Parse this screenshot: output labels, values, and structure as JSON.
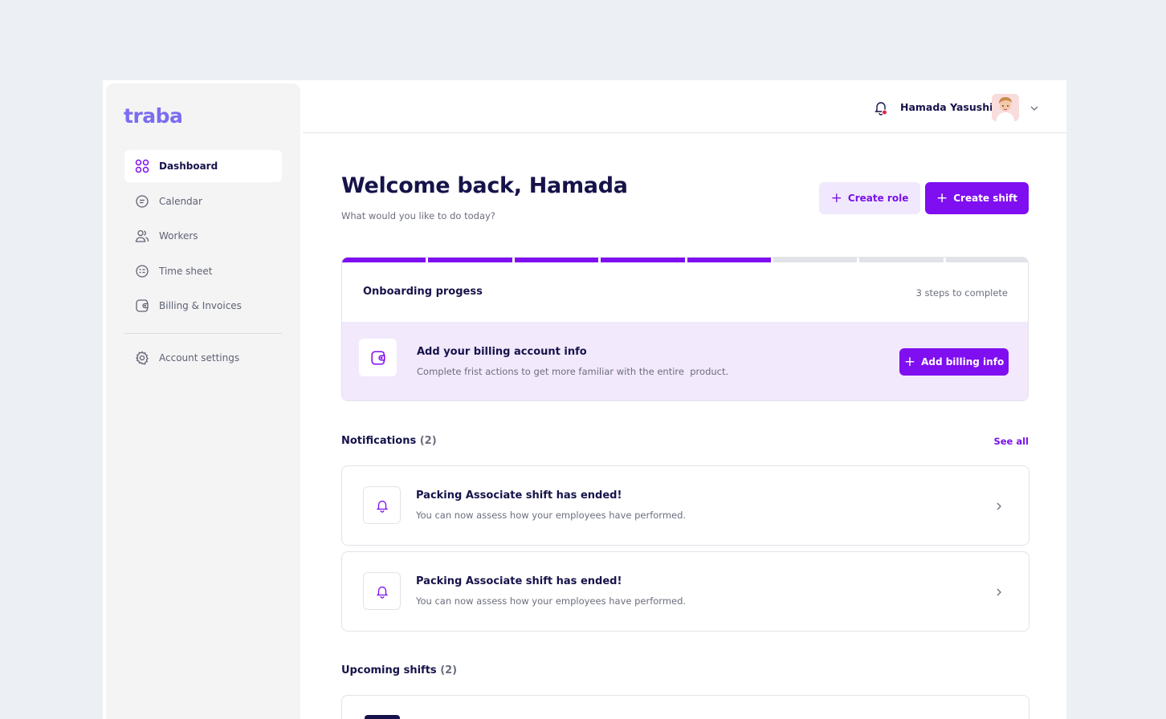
{
  "colors": {
    "accent": "#7f0ef0",
    "accent_light": "#f0e8fc",
    "navy": "#16134a",
    "logo": "#7b6cf0"
  },
  "brand": {
    "logo_text": "traba"
  },
  "sidebar": {
    "items": [
      {
        "label": "Dashboard",
        "icon": "grid-icon",
        "active": true
      },
      {
        "label": "Calendar",
        "icon": "calendar-icon"
      },
      {
        "label": "Workers",
        "icon": "users-icon"
      },
      {
        "label": "Time sheet",
        "icon": "timesheet-icon"
      },
      {
        "label": "Billing & Invoices",
        "icon": "wallet-icon"
      }
    ],
    "footer_items": [
      {
        "label": "Account settings",
        "icon": "gear-icon"
      }
    ]
  },
  "topbar": {
    "user_name": "Hamada Yasushi",
    "bell_icon": "bell-icon",
    "avatar": "user-avatar",
    "menu_icon": "chevron-down-icon"
  },
  "header": {
    "title": "Welcome back, Hamada",
    "subtitle": "What would you like to do today?",
    "create_role_label": "Create role",
    "create_shift_label": "Create shift"
  },
  "onboarding": {
    "title": "Onboarding progess",
    "steps_text": "3 steps to complete",
    "progress": {
      "completed": 5,
      "total": 8
    },
    "task": {
      "title": "Add your billing account info",
      "subtitle": "Complete frist actions to get more familiar with the entire  product.",
      "button_label": "Add billing info",
      "icon": "wallet-icon"
    }
  },
  "notifications": {
    "title": "Notifications",
    "count": "(2)",
    "see_all_label": "See all",
    "items": [
      {
        "title": "Packing Associate shift has ended!",
        "subtitle": "You can now assess how your employees have performed.",
        "icon": "bell-icon"
      },
      {
        "title": "Packing Associate shift has ended!",
        "subtitle": "You can now assess how your employees have performed.",
        "icon": "bell-icon"
      }
    ]
  },
  "upcoming": {
    "title": "Upcoming shifts",
    "count": "(2)"
  }
}
